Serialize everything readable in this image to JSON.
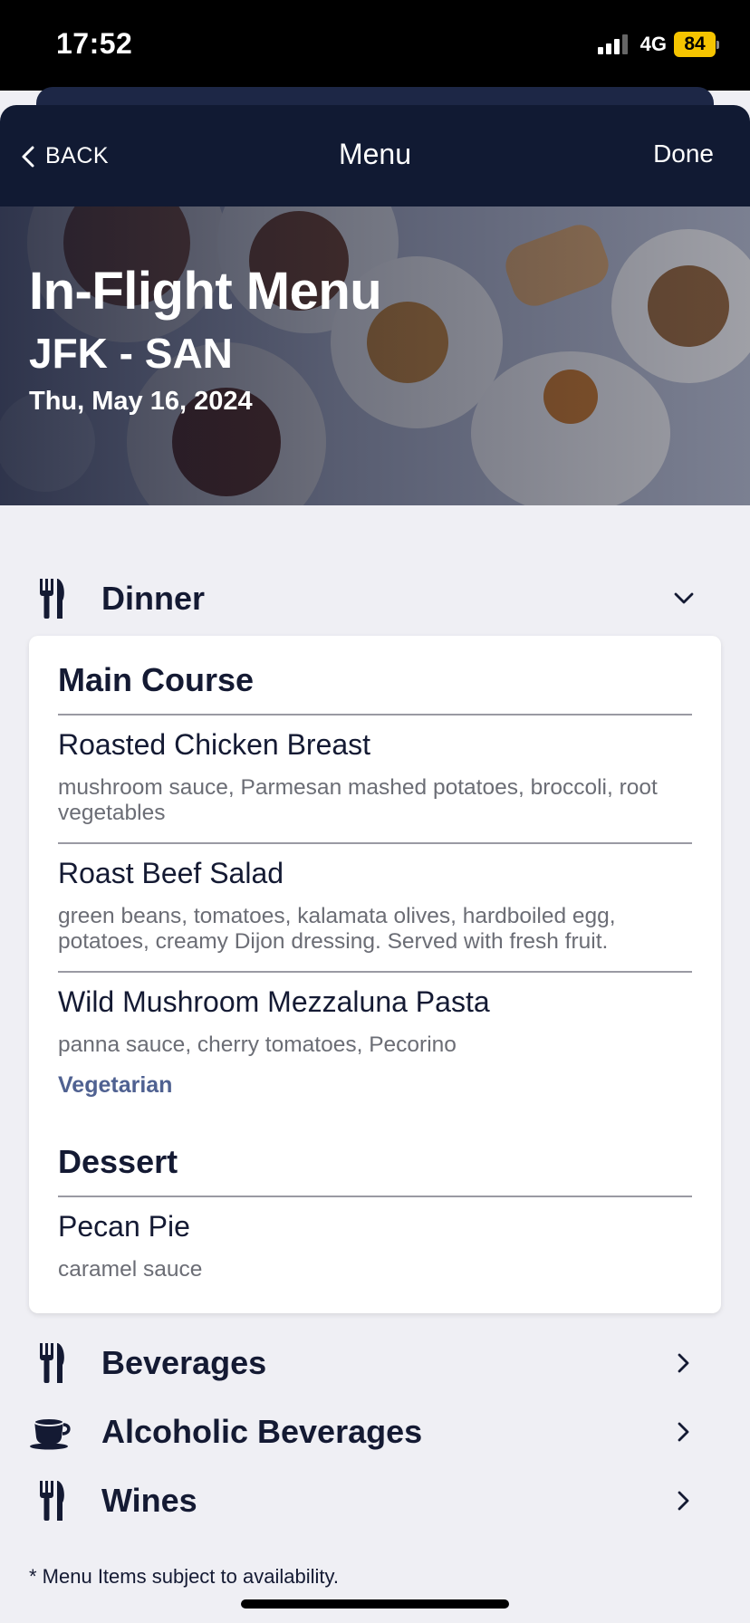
{
  "status_bar": {
    "time": "17:52",
    "network": "4G",
    "battery": "84",
    "battery_color": "#f5c400"
  },
  "nav": {
    "back_label": "BACK",
    "title": "Menu",
    "done_label": "Done"
  },
  "hero": {
    "title": "In-Flight Menu",
    "route": "JFK - SAN",
    "date": "Thu, May 16, 2024"
  },
  "sections": {
    "dinner": {
      "label": "Dinner",
      "icon": "fork-knife-icon",
      "expanded": true
    },
    "beverages": {
      "label": "Beverages",
      "icon": "fork-knife-icon"
    },
    "alcoholic": {
      "label": "Alcoholic Beverages",
      "icon": "coffee-cup-icon"
    },
    "wines": {
      "label": "Wines",
      "icon": "fork-knife-icon"
    }
  },
  "dinner_menu": {
    "main_course": {
      "title": "Main Course",
      "items": [
        {
          "name": "Roasted Chicken Breast",
          "description": "mushroom sauce, Parmesan mashed potatoes, broccoli, root vegetables"
        },
        {
          "name": "Roast Beef Salad",
          "description": "green beans, tomatoes, kalamata olives, hardboiled egg, potatoes, creamy Dijon dressing. Served with fresh fruit."
        },
        {
          "name": "Wild Mushroom Mezzaluna Pasta",
          "description": "panna sauce, cherry tomatoes, Pecorino",
          "tag": "Vegetarian"
        }
      ]
    },
    "dessert": {
      "title": "Dessert",
      "items": [
        {
          "name": "Pecan Pie",
          "description": "caramel sauce"
        }
      ]
    }
  },
  "footnote": "* Menu Items subject to availability.",
  "colors": {
    "navy": "#111a33",
    "tag": "#4f6191",
    "background": "#efeff4"
  }
}
